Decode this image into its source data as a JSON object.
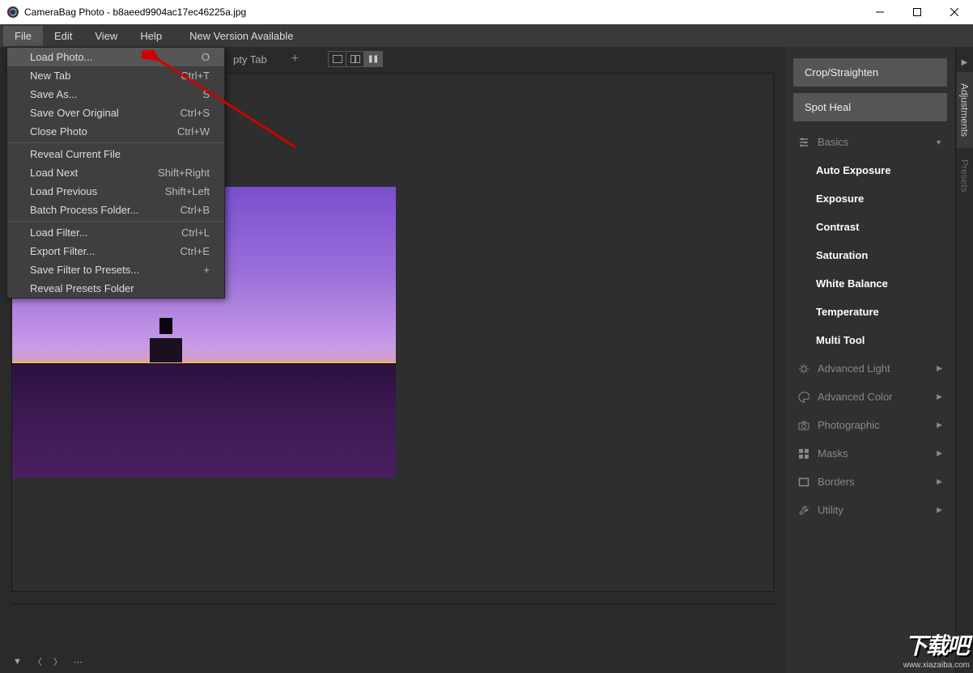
{
  "window": {
    "title": "CameraBag Photo - b8aeed9904ac17ec46225a.jpg"
  },
  "menubar": {
    "file": "File",
    "edit": "Edit",
    "view": "View",
    "help": "Help",
    "new_version": "New Version Available"
  },
  "tabs": {
    "empty": "pty Tab",
    "empty_full": "Empty Tab"
  },
  "file_menu": [
    {
      "label": "Load Photo...",
      "shortcut": "O",
      "highlighted": true
    },
    {
      "label": "New Tab",
      "shortcut": "Ctrl+T"
    },
    {
      "label": "Save As...",
      "shortcut": "S"
    },
    {
      "label": "Save Over Original",
      "shortcut": "Ctrl+S"
    },
    {
      "label": "Close Photo",
      "shortcut": "Ctrl+W"
    },
    {
      "sep": true
    },
    {
      "label": "Reveal Current File",
      "shortcut": ""
    },
    {
      "label": "Load Next",
      "shortcut": "Shift+Right"
    },
    {
      "label": "Load Previous",
      "shortcut": "Shift+Left"
    },
    {
      "label": "Batch Process Folder...",
      "shortcut": "Ctrl+B"
    },
    {
      "sep": true
    },
    {
      "label": "Load Filter...",
      "shortcut": "Ctrl+L"
    },
    {
      "label": "Export Filter...",
      "shortcut": "Ctrl+E"
    },
    {
      "label": "Save Filter to Presets...",
      "shortcut": "+"
    },
    {
      "label": "Reveal Presets Folder",
      "shortcut": ""
    }
  ],
  "right_panel": {
    "crop": "Crop/Straighten",
    "spot_heal": "Spot Heal",
    "categories": [
      {
        "icon": "sliders",
        "label": "Basics",
        "expanded": true,
        "items": [
          "Auto Exposure",
          "Exposure",
          "Contrast",
          "Saturation",
          "White Balance",
          "Temperature",
          "Multi Tool"
        ]
      },
      {
        "icon": "sun",
        "label": "Advanced Light",
        "expanded": false
      },
      {
        "icon": "palette",
        "label": "Advanced Color",
        "expanded": false
      },
      {
        "icon": "camera",
        "label": "Photographic",
        "expanded": false
      },
      {
        "icon": "grid",
        "label": "Masks",
        "expanded": false
      },
      {
        "icon": "rect",
        "label": "Borders",
        "expanded": false
      },
      {
        "icon": "wrench",
        "label": "Utility",
        "expanded": false
      }
    ]
  },
  "side_tabs": {
    "adjustments": "Adjustments",
    "presets": "Presets"
  },
  "watermark": {
    "text": "下载吧",
    "url": "www.xiazaiba.com"
  }
}
